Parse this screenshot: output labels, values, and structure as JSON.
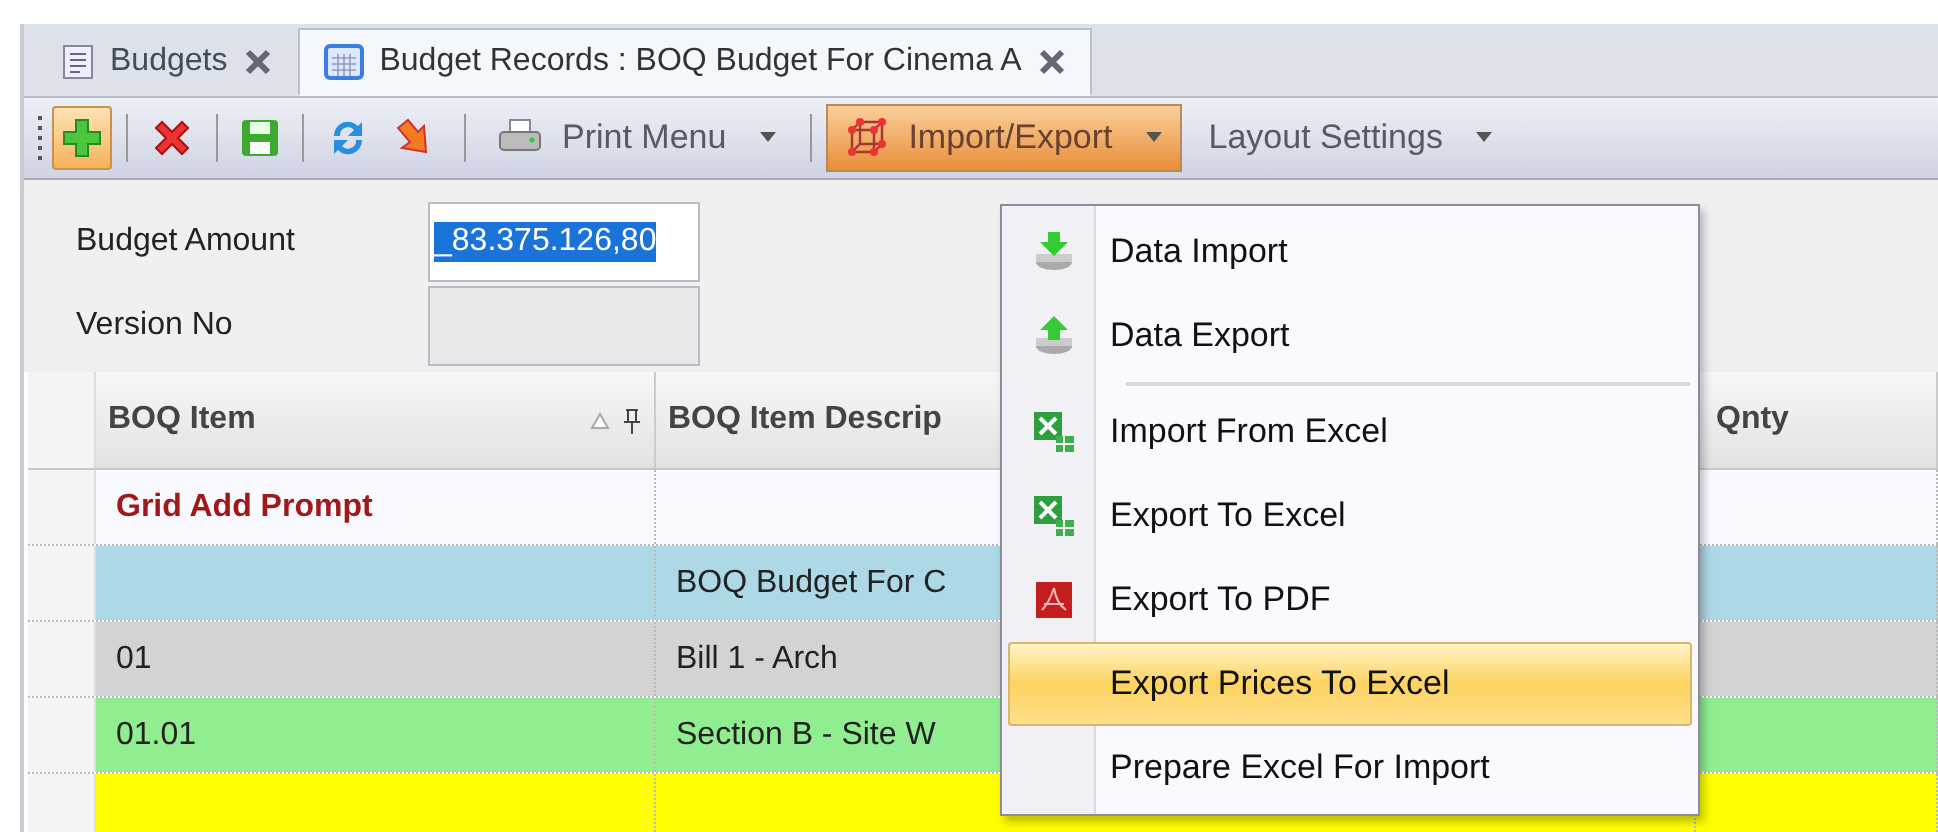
{
  "tabs": [
    {
      "label": "Budgets",
      "selected": false
    },
    {
      "label": "Budget Records : BOQ Budget For Cinema A",
      "selected": true
    }
  ],
  "toolbar": [
    {
      "kind": "icon",
      "highlighted": true
    },
    {
      "kind": "separator"
    },
    {
      "kind": "icon",
      "highlighted": false
    },
    {
      "kind": "separator"
    },
    {
      "kind": "icon",
      "highlighted": false
    },
    {
      "kind": "separator"
    },
    {
      "kind": "icon",
      "highlighted": false
    },
    {
      "kind": "icon",
      "highlighted": false
    },
    {
      "kind": "separator"
    },
    {
      "kind": "menu",
      "label": "Print Menu",
      "open": false
    },
    {
      "kind": "separator"
    },
    {
      "kind": "menu",
      "label": "Import/Export",
      "open": true
    },
    {
      "kind": "menu",
      "label": "Layout Settings",
      "open": false
    }
  ],
  "form": {
    "fields": [
      {
        "label": "Budget Amount",
        "value": "_83.375.126,80",
        "focused": true
      },
      {
        "label": "Version No",
        "focused": false
      }
    ]
  },
  "grid": {
    "columns": [
      {
        "label": "BOQ Item"
      },
      {
        "label": "BOQ Item Descrip"
      },
      {
        "label": "Qnty"
      }
    ],
    "rows": [
      {
        "kind": "add_prompt",
        "item": "Grid Add Prompt"
      },
      {
        "kind": "data",
        "color": "#add8e6",
        "description": "BOQ Budget For C"
      },
      {
        "kind": "data",
        "color": "#d3d3d3",
        "item": "01",
        "description": "Bill 1 - Arch"
      },
      {
        "kind": "data",
        "color": "#90ee90",
        "item": "01.01",
        "description": "Section B - Site W"
      },
      {
        "kind": "data",
        "color": "#ffff00"
      }
    ]
  },
  "menu": [
    {
      "kind": "item",
      "label": "Data Import",
      "selected": false
    },
    {
      "kind": "item",
      "label": "Data Export",
      "selected": false
    },
    {
      "kind": "separator"
    },
    {
      "kind": "item",
      "label": "Import From Excel",
      "selected": false
    },
    {
      "kind": "item",
      "label": "Export To Excel",
      "selected": false
    },
    {
      "kind": "item",
      "label": "Export To PDF",
      "selected": false
    },
    {
      "kind": "item",
      "label": "Export Prices To Excel",
      "selected": true
    },
    {
      "kind": "item",
      "label": "Prepare Excel For Import",
      "selected": false
    }
  ]
}
